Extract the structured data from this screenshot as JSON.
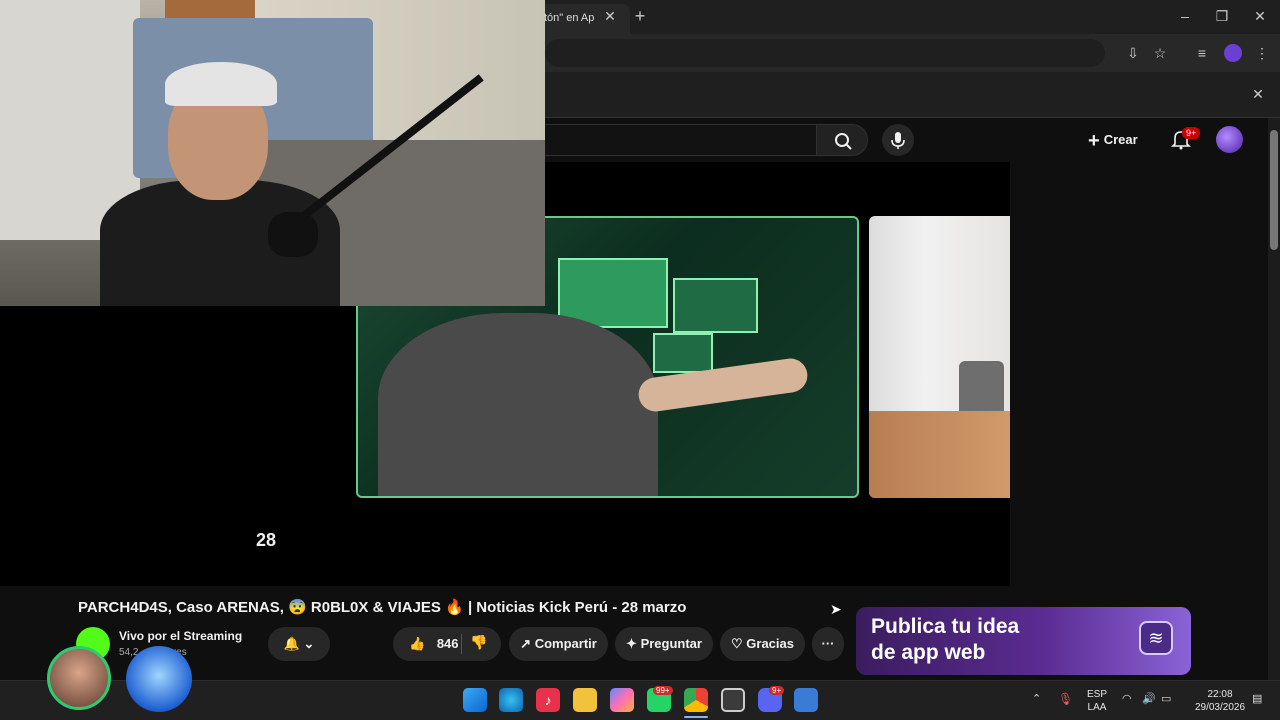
{
  "browser": {
    "tab_title": "tón\" en Ap",
    "window_controls": {
      "minimize": "–",
      "maximize": "❐",
      "close": "✕"
    },
    "new_tab": "+"
  },
  "youtube": {
    "create_label": "Crear",
    "notifications_badge": "9+"
  },
  "video": {
    "overlay_number": "28"
  },
  "meta": {
    "title": "PARCH4D4S, Caso ARENAS, 😨 R0BL0X & VIAJES 🔥 | Noticias Kick Perú - 28 marzo",
    "channel_name": "Vivo por el Streaming",
    "subscribers": "54,2",
    "subscribers_suffix": "tores",
    "likes": "846",
    "share_label": "Compartir",
    "ask_label": "Preguntar",
    "thanks_label": "Gracias",
    "more_label": "···"
  },
  "ad": {
    "line1": "Publica tu idea",
    "line2": "de app web"
  },
  "taskbar": {
    "whatsapp_badge": "99+",
    "discord_badge": "9+",
    "language": "ESP",
    "layout": "LAA",
    "time": "22:08",
    "date": "29/03/2026"
  },
  "colors": {
    "youtube_red": "#cc0000",
    "green_border": "#67c98a",
    "ad_purple": "#5a2b91"
  }
}
